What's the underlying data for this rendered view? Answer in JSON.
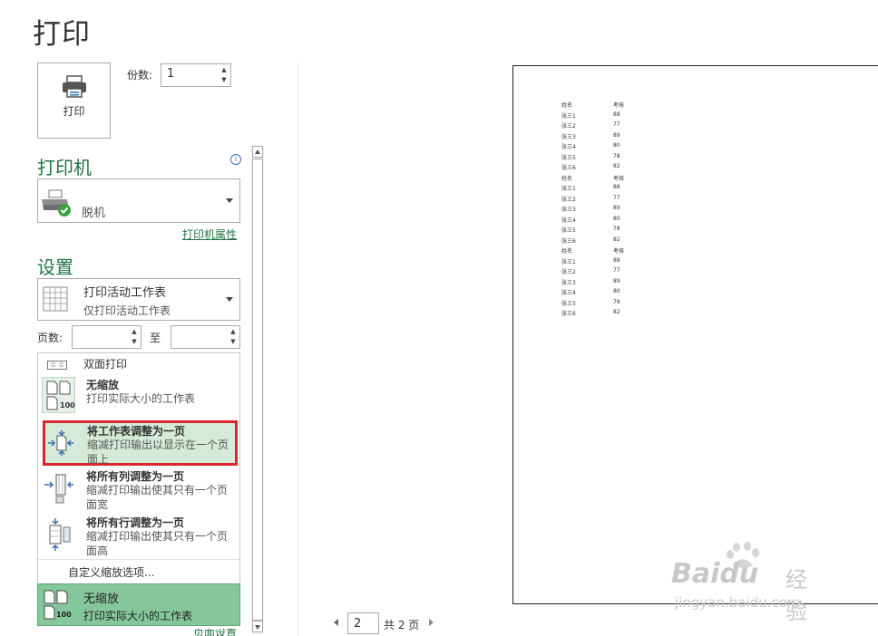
{
  "page": {
    "title": "打印"
  },
  "print_button": {
    "label": "打印",
    "icon": "printer-icon"
  },
  "copies": {
    "label": "份数:",
    "value": "1"
  },
  "printer": {
    "section_title": "打印机",
    "info_icon": "info-icon",
    "name": "",
    "status": "脱机",
    "icon": "printer-ready-icon",
    "properties_link": "打印机属性"
  },
  "settings": {
    "section_title": "设置",
    "scope": {
      "title": "打印活动工作表",
      "subtitle": "仅打印活动工作表",
      "icon": "sheet-grid-icon"
    },
    "pages": {
      "label": "页数:",
      "from": "",
      "to_label": "至",
      "to": ""
    },
    "duplex_label": "双面打印",
    "scaling_menu": [
      {
        "title": "无缩放",
        "desc": "打印实际大小的工作表",
        "icon": "no-scaling-icon",
        "badge": "100"
      },
      {
        "title": "将工作表调整为一页",
        "desc": "缩减打印输出以显示在一个页面上",
        "icon": "fit-sheet-icon",
        "highlighted": true
      },
      {
        "title": "将所有列调整为一页",
        "desc": "缩减打印输出使其只有一个页面宽",
        "icon": "fit-columns-icon"
      },
      {
        "title": "将所有行调整为一页",
        "desc": "缩减打印输出使其只有一个页面高",
        "icon": "fit-rows-icon"
      }
    ],
    "custom_scaling": "自定义缩放选项...",
    "current_scaling": {
      "title": "无缩放",
      "desc": "打印实际大小的工作表",
      "badge": "100"
    },
    "page_setup_link": "页面设置"
  },
  "preview": {
    "headers": [
      "姓名",
      "考核"
    ],
    "blocks": [
      [
        [
          "张三1",
          "88"
        ],
        [
          "张三2",
          "77"
        ],
        [
          "张三3",
          "89"
        ],
        [
          "张三4",
          "80"
        ],
        [
          "张三5",
          "78"
        ],
        [
          "张三6",
          "82"
        ]
      ],
      [
        [
          "张三1",
          "88"
        ],
        [
          "张三2",
          "77"
        ],
        [
          "张三3",
          "89"
        ],
        [
          "张三4",
          "80"
        ],
        [
          "张三5",
          "78"
        ],
        [
          "张三6",
          "82"
        ]
      ],
      [
        [
          "张三1",
          "88"
        ],
        [
          "张三2",
          "77"
        ],
        [
          "张三3",
          "89"
        ],
        [
          "张三4",
          "80"
        ],
        [
          "张三5",
          "78"
        ],
        [
          "张三6",
          "82"
        ]
      ]
    ]
  },
  "pager": {
    "current": "2",
    "total_text": "共 2 页"
  },
  "watermark": {
    "brand": "Baidu",
    "brand_cn": "经验",
    "url": "jingyan.baidu.com"
  },
  "colors": {
    "accent": "#217346",
    "highlight_fill": "#d5ead9",
    "selected_fill": "#85c79b",
    "red_frame": "#d9262a"
  }
}
